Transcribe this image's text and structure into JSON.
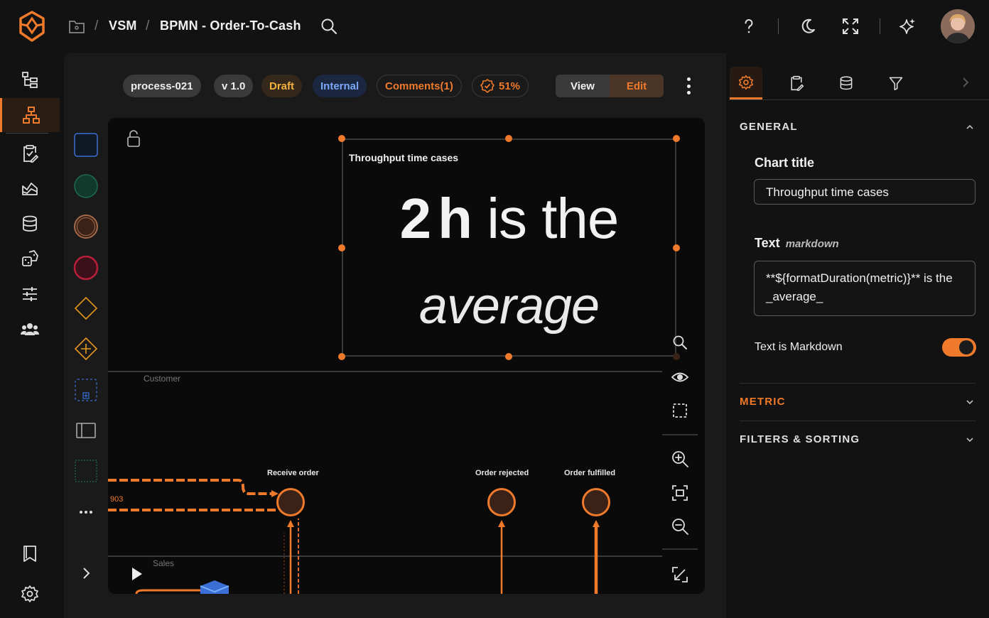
{
  "breadcrumb": {
    "separator": "/",
    "item1": "VSM",
    "item2": "BPMN - Order-To-Cash"
  },
  "icons": {
    "logo": "brand-logo-icon",
    "folder": "folder-icon",
    "search": "search-icon",
    "help": "help-icon",
    "theme": "moon-icon",
    "fullscreen": "expand-icon",
    "ai": "sparkle-icon"
  },
  "chips": {
    "process_id": "process-021",
    "version": "v 1.0",
    "status": "Draft",
    "visibility": "Internal",
    "comments": "Comments(1)",
    "progress": "51%"
  },
  "mode": {
    "view": "View",
    "edit": "Edit",
    "active": "Edit"
  },
  "canvas": {
    "chart_title": "Throughput time cases",
    "big_value": "2",
    "big_unit": "h",
    "big_text": " is the",
    "big_italic": "average",
    "lanes": [
      "Customer",
      "Sales"
    ],
    "nodes": [
      "Receive order",
      "Order rejected",
      "Order fulfilled"
    ],
    "flow_count": "903"
  },
  "right_panel": {
    "general_title": "GENERAL",
    "chart_title_label": "Chart title",
    "chart_title_value": "Throughput time cases",
    "text_label": "Text",
    "text_sub": "markdown",
    "text_value": "**${formatDuration(metric)}** is the _average_",
    "markdown_toggle_label": "Text is Markdown",
    "markdown_toggle_on": true,
    "metric_title": "METRIC",
    "filters_title": "FILTERS & SORTING"
  },
  "colors": {
    "accent": "#f07a2b",
    "bg": "#121212",
    "canvas": "#0a0a0a"
  }
}
